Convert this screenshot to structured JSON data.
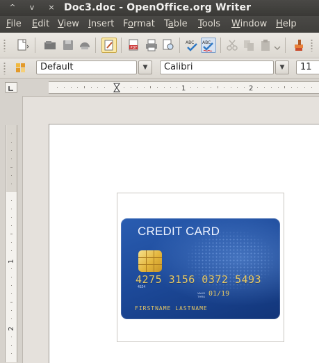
{
  "window": {
    "title": "Doc3.doc - OpenOffice.org Writer",
    "controls": [
      "^",
      "v",
      "×"
    ]
  },
  "menubar": {
    "items": [
      {
        "accel": "F",
        "rest": "ile"
      },
      {
        "accel": "E",
        "rest": "dit"
      },
      {
        "accel": "V",
        "rest": "iew"
      },
      {
        "accel": "I",
        "rest": "nsert"
      },
      {
        "pre": "F",
        "accel": "o",
        "rest": "rmat"
      },
      {
        "pre": "T",
        "accel": "a",
        "rest": "ble"
      },
      {
        "accel": "T",
        "rest": "ools"
      },
      {
        "accel": "W",
        "rest": "indow"
      },
      {
        "accel": "H",
        "rest": "elp"
      }
    ]
  },
  "toolbar": {
    "icons": [
      "new-document-icon",
      "open-icon",
      "save-icon",
      "email-icon",
      "edit-file-icon",
      "export-pdf-icon",
      "print-icon",
      "print-preview-icon",
      "spellcheck-icon",
      "autospellcheck-icon",
      "cut-icon",
      "copy-icon",
      "paste-icon",
      "format-paintbrush-icon"
    ],
    "pdf_label": "PDF",
    "abc_label": "ABC"
  },
  "formatting": {
    "paragraph_style": "Default",
    "font_name": "Calibri",
    "font_size": "11"
  },
  "ruler": {
    "h_labels": [
      "1",
      "2"
    ],
    "v_labels": [
      "1",
      "2"
    ]
  },
  "document": {
    "image": {
      "card_title": "CREDIT CARD",
      "card_number": "4275 3156 0372 5493",
      "card_small_number": "4524",
      "valid_thru_label": "VALID THRU",
      "expiry": "01/19",
      "cardholder": "FIRSTNAME LASTNAME"
    }
  },
  "colors": {
    "titlebar": "#3f3e3b",
    "card_blue": "#1d4a9a",
    "card_gold": "#e7c864"
  }
}
